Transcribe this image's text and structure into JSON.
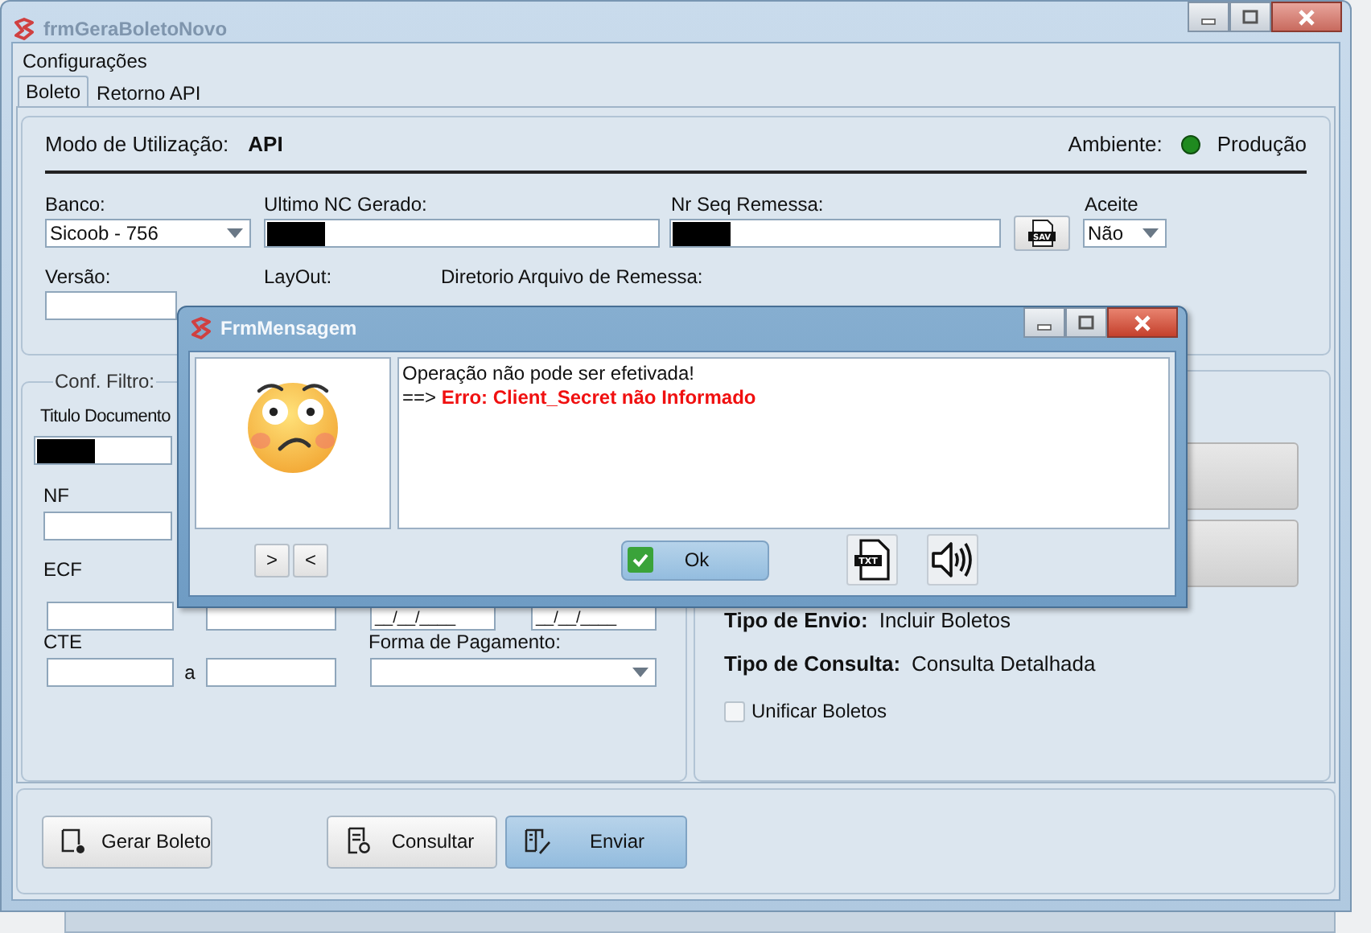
{
  "window": {
    "title": "frmGeraBoletoNovo",
    "active": false
  },
  "menu": [
    "Configurações"
  ],
  "tabs": [
    {
      "label": "Boleto",
      "selected": true
    },
    {
      "label": "Retorno API",
      "selected": false
    }
  ],
  "header": {
    "mode_label": "Modo de Utilização:",
    "mode_value": "API",
    "env_label": "Ambiente:",
    "env_value": "Produção"
  },
  "banco": {
    "label": "Banco:",
    "value": "Sicoob - 756"
  },
  "ultimo_nc": {
    "label": "Ultimo NC Gerado:",
    "redacted": true
  },
  "nr_seq": {
    "label": "Nr Seq Remessa:",
    "redacted": true
  },
  "save_button": {
    "icon_label": "SAV"
  },
  "aceite": {
    "label": "Aceite",
    "value": "Não"
  },
  "versao": {
    "label": "Versão:"
  },
  "layout": {
    "label": "LayOut:"
  },
  "diretorio": {
    "label": "Diretorio Arquivo de Remessa:"
  },
  "filter": {
    "legend": "Conf. Filtro:",
    "titulo_label": "Titulo Documento",
    "titulo_redacted": true,
    "nf_label": "NF",
    "ecf_label": "ECF",
    "date_masks": [
      "__/__/____",
      "__/__/____"
    ],
    "cte_label": "CTE",
    "range_sep": "a",
    "payment_label": "Forma de Pagamento:"
  },
  "send_info": {
    "items": [
      {
        "label": "Tipo de Envio:",
        "value": "Incluir Boletos"
      },
      {
        "label": "Tipo de Consulta:",
        "value": "Consulta Detalhada"
      }
    ],
    "unify": {
      "label": "Unificar Boletos",
      "checked": false
    }
  },
  "actions": [
    {
      "label": "Gerar Boleto",
      "kind": "generate",
      "selected": false
    },
    {
      "label": "Consultar",
      "kind": "query",
      "selected": false
    },
    {
      "label": "Enviar",
      "kind": "send",
      "selected": true
    }
  ],
  "dialog": {
    "title": "FrmMensagem",
    "lines": [
      "Operação não pode ser efetivada!",
      "==> **Erro: Client_Secret não Informado**"
    ],
    "nav_buttons": [
      ">",
      "<"
    ],
    "ok": "Ok",
    "file_icon_label": "TXT"
  }
}
